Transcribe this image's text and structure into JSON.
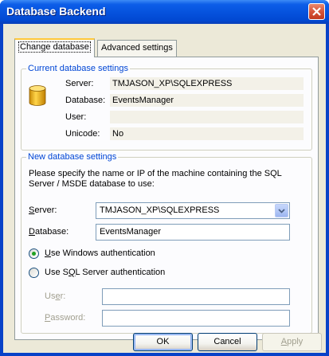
{
  "window": {
    "title": "Database Backend"
  },
  "tabs": [
    {
      "label": "Change database",
      "active": true
    },
    {
      "label": "Advanced settings",
      "active": false
    }
  ],
  "current_settings": {
    "group_label": "Current database settings",
    "icon": "database-icon",
    "rows": [
      {
        "label": "Server:",
        "value": "TMJASON_XP\\SQLEXPRESS"
      },
      {
        "label": "Database:",
        "value": "EventsManager"
      },
      {
        "label": "User:",
        "value": ""
      },
      {
        "label": "Unicode:",
        "value": "No"
      }
    ]
  },
  "new_settings": {
    "group_label": "New database settings",
    "description_line1": "Please specify the name or IP of the machine containing the SQL",
    "description_line2": "Server / MSDE database to use:",
    "server_label_pre": "",
    "server_label_u": "S",
    "server_label_post": "erver:",
    "server_value": "TMJASON_XP\\SQLEXPRESS",
    "database_label_u": "D",
    "database_label_post": "atabase:",
    "database_value": "EventsManager",
    "radio_windows_u": "U",
    "radio_windows_post": "se Windows authentication",
    "radio_sql_pre": "Use S",
    "radio_sql_u": "Q",
    "radio_sql_post": "L Server authentication",
    "auth_selected": "windows",
    "user_label_pre": "Us",
    "user_label_u": "e",
    "user_label_post": "r:",
    "user_value": "",
    "password_label_u": "P",
    "password_label_post": "assword:",
    "password_value": ""
  },
  "buttons": {
    "ok": "OK",
    "cancel": "Cancel",
    "apply_u": "A",
    "apply_post": "pply"
  },
  "colors": {
    "title_bar": "#0653de",
    "group_label": "#0046d5",
    "dialog_bg": "#ece9d8",
    "close_button": "#d6553a",
    "radio_selected": "#21a121"
  }
}
